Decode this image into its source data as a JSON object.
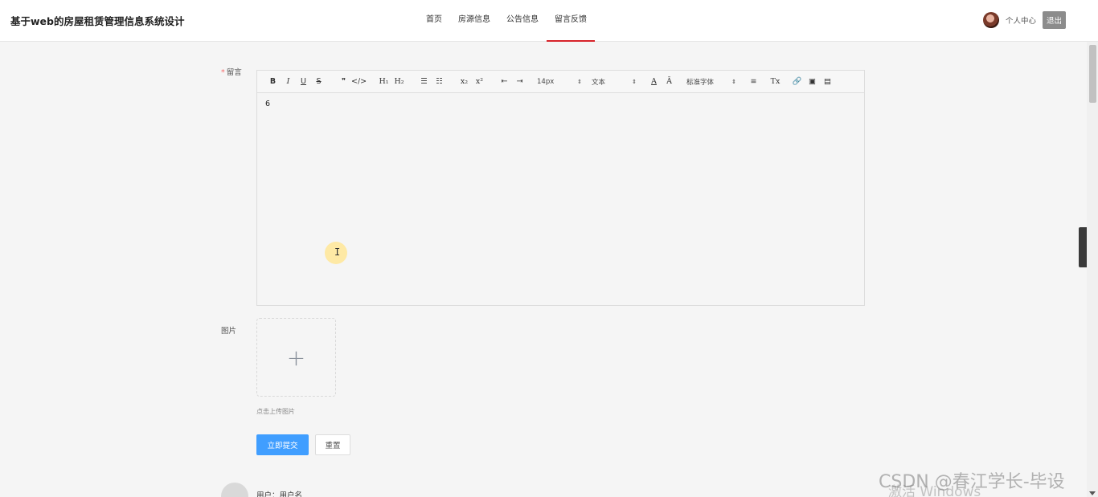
{
  "header": {
    "site_title": "基于web的房屋租赁管理信息系统设计",
    "nav": [
      {
        "label": "首页",
        "active": false
      },
      {
        "label": "房源信息",
        "active": false
      },
      {
        "label": "公告信息",
        "active": false
      },
      {
        "label": "留言反馈",
        "active": true
      }
    ],
    "user_center": "个人中心",
    "logout": "退出"
  },
  "form": {
    "message_label": "留言",
    "required_mark": "*",
    "editor": {
      "toolbar": {
        "bold": "B",
        "italic": "I",
        "underline": "U",
        "strike": "S",
        "quote": "❞",
        "code": "</>",
        "h1": "H₁",
        "h2": "H₂",
        "ordered_list": "☰",
        "bullet_list": "☷",
        "subscript": "x₂",
        "superscript": "x²",
        "outdent": "⇤",
        "indent": "⇥",
        "font_size": "14px",
        "heading": "文本",
        "font_color": "A",
        "bg_color": "Ā",
        "font_family": "标准字体",
        "align": "≡",
        "clean": "Tx",
        "link": "🔗",
        "image": "▣",
        "video": "▤"
      },
      "content": "6"
    },
    "image_label": "图片",
    "upload_plus": "+",
    "upload_tip": "点击上传图片",
    "submit": "立即提交",
    "reset": "重置"
  },
  "comment": {
    "user": "用户：用户名"
  },
  "watermarks": {
    "csdn": "CSDN @春江学长-毕设",
    "activate": "激活 Windows"
  },
  "side_toggle": "‹"
}
